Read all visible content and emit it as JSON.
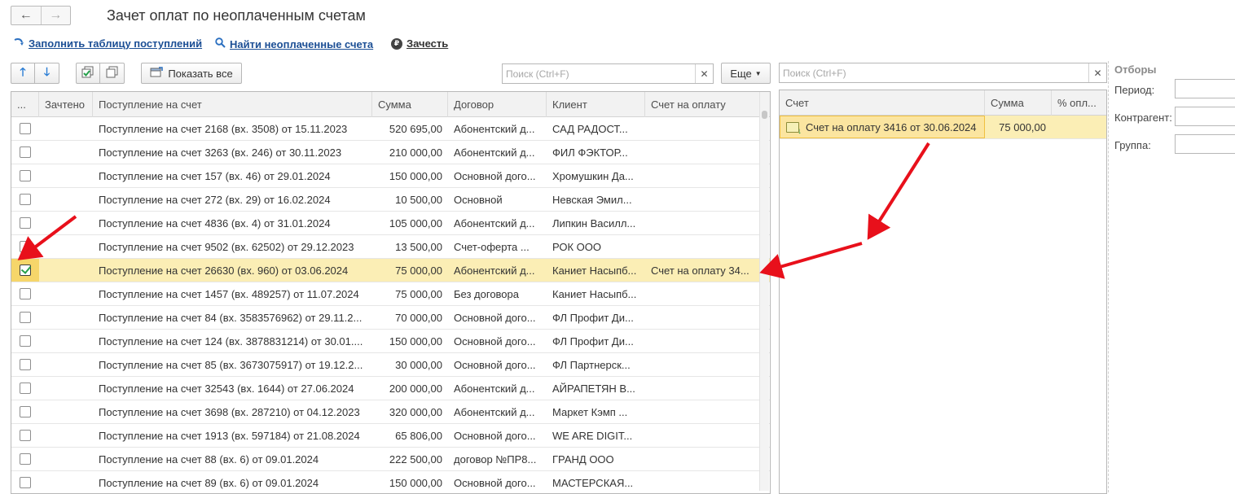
{
  "window": {
    "title": "Зачет оплат по неоплаченным счетам",
    "nav_back": "←",
    "nav_forward": "→"
  },
  "commands": {
    "fill_table": "Заполнить таблицу поступлений",
    "find_unpaid": "Найти неоплаченные счета",
    "offset": "Зачесть"
  },
  "toolbar": {
    "show_all": "Показать все",
    "more": "Еще",
    "search_placeholder": "Поиск (Ctrl+F)"
  },
  "receipts_table": {
    "columns": [
      "...",
      "Зачтено",
      "Поступление на счет",
      "Сумма",
      "Договор",
      "Клиент",
      "Счет на оплату"
    ],
    "rows": [
      {
        "checked": false,
        "credited": "",
        "receipt": "Поступление на счет 2168 (вх. 3508) от 15.11.2023",
        "amount": "520 695,00",
        "contract": "Абонентский д...",
        "client": "САД РАДОСТ...",
        "invoice": ""
      },
      {
        "checked": false,
        "credited": "",
        "receipt": "Поступление на счет 3263 (вх. 246) от 30.11.2023",
        "amount": "210 000,00",
        "contract": "Абонентский д...",
        "client": "ФИЛ ФЭКТОР...",
        "invoice": ""
      },
      {
        "checked": false,
        "credited": "",
        "receipt": "Поступление на счет 157 (вх. 46) от 29.01.2024",
        "amount": "150 000,00",
        "contract": "Основной дого...",
        "client": "Хромушкин Да...",
        "invoice": ""
      },
      {
        "checked": false,
        "credited": "",
        "receipt": "Поступление на счет 272 (вх. 29) от 16.02.2024",
        "amount": "10 500,00",
        "contract": "Основной",
        "client": "Невская Эмил...",
        "invoice": ""
      },
      {
        "checked": false,
        "credited": "",
        "receipt": "Поступление на счет 4836 (вх. 4) от 31.01.2024",
        "amount": "105 000,00",
        "contract": "Абонентский д...",
        "client": "Липкин Василл...",
        "invoice": ""
      },
      {
        "checked": false,
        "credited": "",
        "receipt": "Поступление на счет 9502 (вх. 62502) от 29.12.2023",
        "amount": "13 500,00",
        "contract": "Счет-оферта ...",
        "client": "РОК ООО",
        "invoice": ""
      },
      {
        "checked": true,
        "credited": "",
        "receipt": "Поступление на счет 26630 (вх. 960) от 03.06.2024",
        "amount": "75 000,00",
        "contract": "Абонентский д...",
        "client": "Каниет Насыпб...",
        "invoice": "Счет на оплату 34..."
      },
      {
        "checked": false,
        "credited": "",
        "receipt": "Поступление на счет 1457 (вх. 489257) от 11.07.2024",
        "amount": "75 000,00",
        "contract": "Без договора",
        "client": "Каниет Насыпб...",
        "invoice": ""
      },
      {
        "checked": false,
        "credited": "",
        "receipt": "Поступление на счет 84 (вх. 3583576962) от 29.11.2...",
        "amount": "70 000,00",
        "contract": "Основной дого...",
        "client": "ФЛ Профит Ди...",
        "invoice": ""
      },
      {
        "checked": false,
        "credited": "",
        "receipt": "Поступление на счет 124 (вх. 3878831214) от 30.01....",
        "amount": "150 000,00",
        "contract": "Основной дого...",
        "client": "ФЛ Профит Ди...",
        "invoice": ""
      },
      {
        "checked": false,
        "credited": "",
        "receipt": "Поступление на счет 85 (вх. 3673075917) от 19.12.2...",
        "amount": "30 000,00",
        "contract": "Основной дого...",
        "client": "ФЛ Партнерск...",
        "invoice": ""
      },
      {
        "checked": false,
        "credited": "",
        "receipt": "Поступление на счет 32543 (вх. 1644) от 27.06.2024",
        "amount": "200 000,00",
        "contract": "Абонентский д...",
        "client": "АЙРАПЕТЯН В...",
        "invoice": ""
      },
      {
        "checked": false,
        "credited": "",
        "receipt": "Поступление на счет 3698 (вх. 287210) от 04.12.2023",
        "amount": "320 000,00",
        "contract": "Абонентский д...",
        "client": "Маркет Кэмп ...",
        "invoice": ""
      },
      {
        "checked": false,
        "credited": "",
        "receipt": "Поступление на счет 1913 (вх. 597184) от 21.08.2024",
        "amount": "65 806,00",
        "contract": "Основной дого...",
        "client": "WE ARE DIGIT...",
        "invoice": ""
      },
      {
        "checked": false,
        "credited": "",
        "receipt": "Поступление на счет 88 (вх. 6) от 09.01.2024",
        "amount": "222 500,00",
        "contract": "договор №ПР8...",
        "client": "ГРАНД ООО",
        "invoice": ""
      },
      {
        "checked": false,
        "credited": "",
        "receipt": "Поступление на счет 89 (вх. 6) от 09.01.2024",
        "amount": "150 000,00",
        "contract": "Основной дого...",
        "client": "МАСТЕРСКАЯ...",
        "invoice": ""
      }
    ]
  },
  "invoices_table": {
    "columns": [
      "Счет",
      "Сумма",
      "% опл..."
    ],
    "rows": [
      {
        "invoice": "Счет на оплату 3416 от 30.06.2024",
        "amount": "75 000,00",
        "percent": ""
      }
    ]
  },
  "filters": {
    "title": "Отборы",
    "period": "Период:",
    "counterparty": "Контрагент:",
    "group": "Группа:"
  },
  "colors": {
    "link": "#1c4f95",
    "selected_row": "#fbeeb5",
    "annotation_arrow": "#e8101b"
  }
}
